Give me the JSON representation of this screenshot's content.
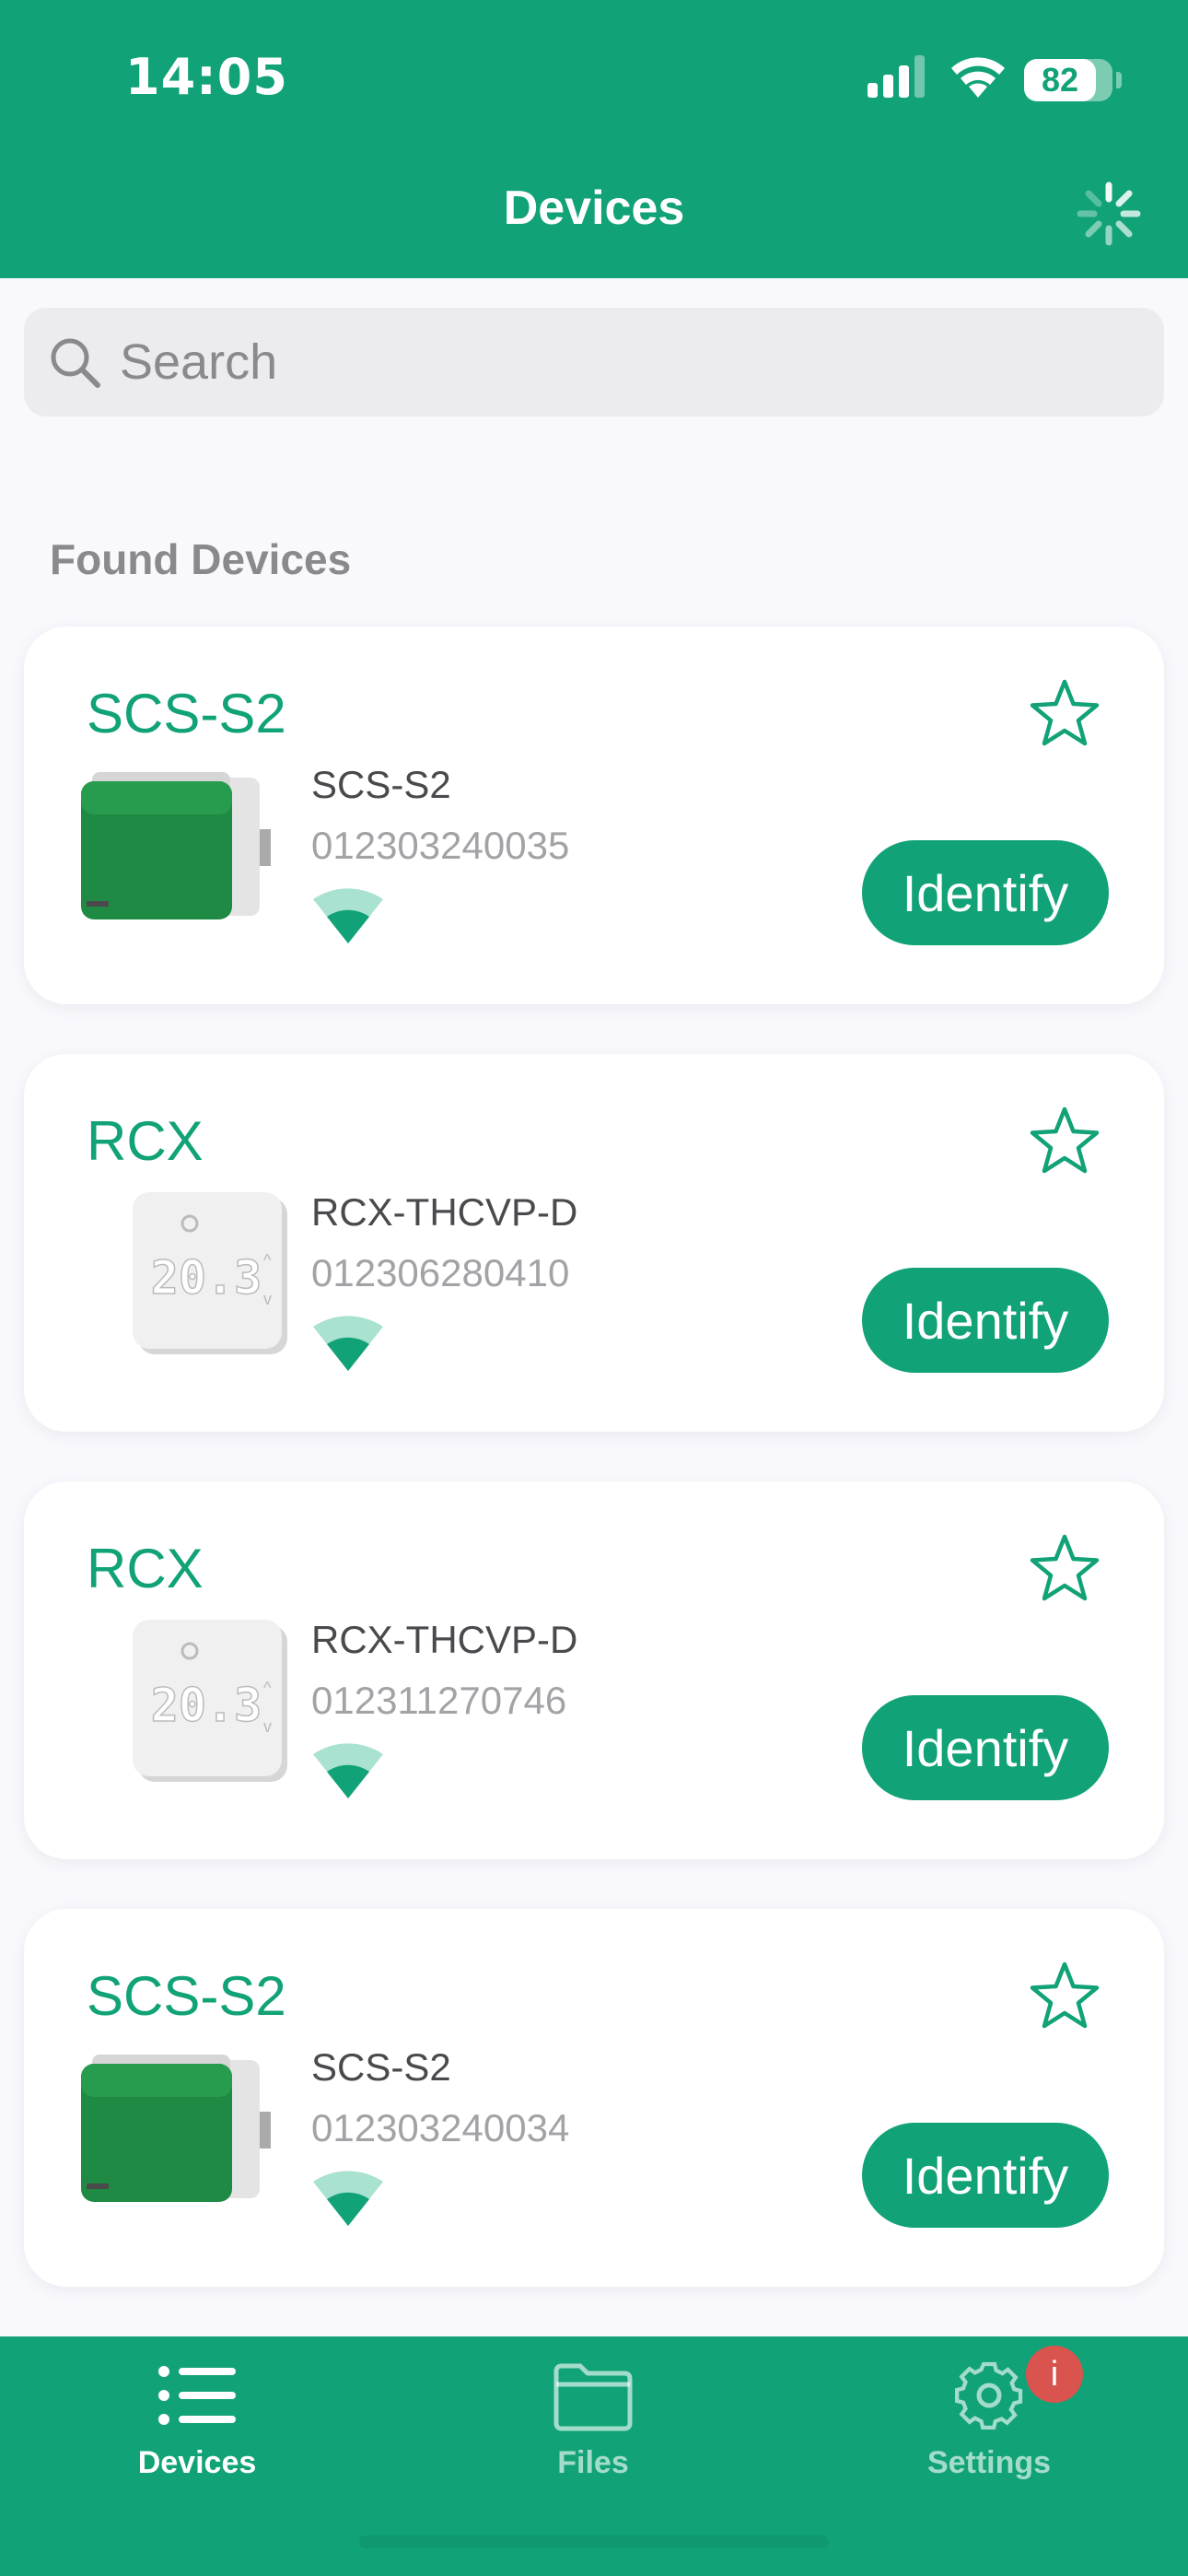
{
  "status_bar": {
    "time": "14:05",
    "battery": "82"
  },
  "nav": {
    "title": "Devices"
  },
  "search": {
    "placeholder": "Search"
  },
  "section": {
    "title": "Found Devices"
  },
  "devices": [
    {
      "name": "SCS-S2",
      "model": "SCS-S2",
      "serial": "012303240035",
      "button": "Identify",
      "image": "actuator-box-image"
    },
    {
      "name": "RCX",
      "model": "RCX-THCVP-D",
      "serial": "012306280410",
      "button": "Identify",
      "image": "thermostat-image"
    },
    {
      "name": "RCX",
      "model": "RCX-THCVP-D",
      "serial": "012311270746",
      "button": "Identify",
      "image": "thermostat-image"
    },
    {
      "name": "SCS-S2",
      "model": "SCS-S2",
      "serial": "012303240034",
      "button": "Identify",
      "image": "actuator-box-image"
    }
  ],
  "tabbar": {
    "tabs": [
      {
        "label": "Devices",
        "icon": "list-icon",
        "active": true
      },
      {
        "label": "Files",
        "icon": "folder-icon",
        "active": false
      },
      {
        "label": "Settings",
        "icon": "gear-icon",
        "active": false,
        "badge": "i"
      }
    ]
  },
  "colors": {
    "accent": "#11a277",
    "badge": "#d9534f",
    "background": "#f8f8fd"
  }
}
